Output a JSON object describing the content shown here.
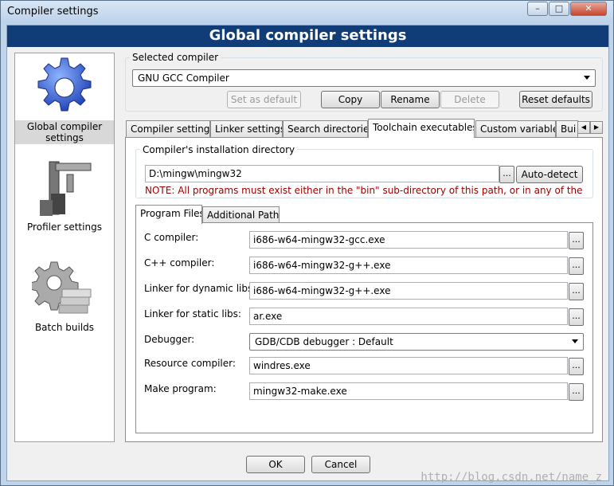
{
  "window": {
    "title": "Compiler settings",
    "minimize": "–",
    "maximize": "□",
    "close": "✕"
  },
  "header": {
    "title": "Global compiler settings"
  },
  "sidebar": {
    "items": [
      {
        "label": "Global compiler settings",
        "icon": "gear-icon",
        "selected": true
      },
      {
        "label": "Profiler settings",
        "icon": "caliper-icon",
        "selected": false
      },
      {
        "label": "Batch builds",
        "icon": "batch-gear-icon",
        "selected": false
      }
    ]
  },
  "compiler": {
    "group_label": "Selected compiler",
    "selected": "GNU GCC Compiler",
    "buttons": {
      "set_default": "Set as default",
      "copy": "Copy",
      "rename": "Rename",
      "delete": "Delete",
      "reset": "Reset defaults"
    }
  },
  "tabs": [
    {
      "label": "Compiler settings"
    },
    {
      "label": "Linker settings"
    },
    {
      "label": "Search directories"
    },
    {
      "label": "Toolchain executables",
      "active": true
    },
    {
      "label": "Custom variables"
    },
    {
      "label": "Bui"
    }
  ],
  "install": {
    "group_label": "Compiler's installation directory",
    "path": "D:\\mingw\\mingw32",
    "browse": "...",
    "autodetect": "Auto-detect",
    "note": "NOTE: All programs must exist either in the \"bin\" sub-directory of this path, or in any of the"
  },
  "subtabs": [
    {
      "label": "Program Files",
      "active": true
    },
    {
      "label": "Additional Paths"
    }
  ],
  "programs": [
    {
      "label": "C compiler:",
      "value": "i686-w64-mingw32-gcc.exe"
    },
    {
      "label": "C++ compiler:",
      "value": "i686-w64-mingw32-g++.exe"
    },
    {
      "label": "Linker for dynamic libs:",
      "value": "i686-w64-mingw32-g++.exe"
    },
    {
      "label": "Linker for static libs:",
      "value": "ar.exe"
    },
    {
      "label": "Debugger:",
      "value": "GDB/CDB debugger : Default"
    },
    {
      "label": "Resource compiler:",
      "value": "windres.exe"
    },
    {
      "label": "Make program:",
      "value": "mingw32-make.exe"
    }
  ],
  "dialog": {
    "ok": "OK",
    "cancel": "Cancel"
  },
  "watermark": "http://blog.csdn.net/name_z"
}
